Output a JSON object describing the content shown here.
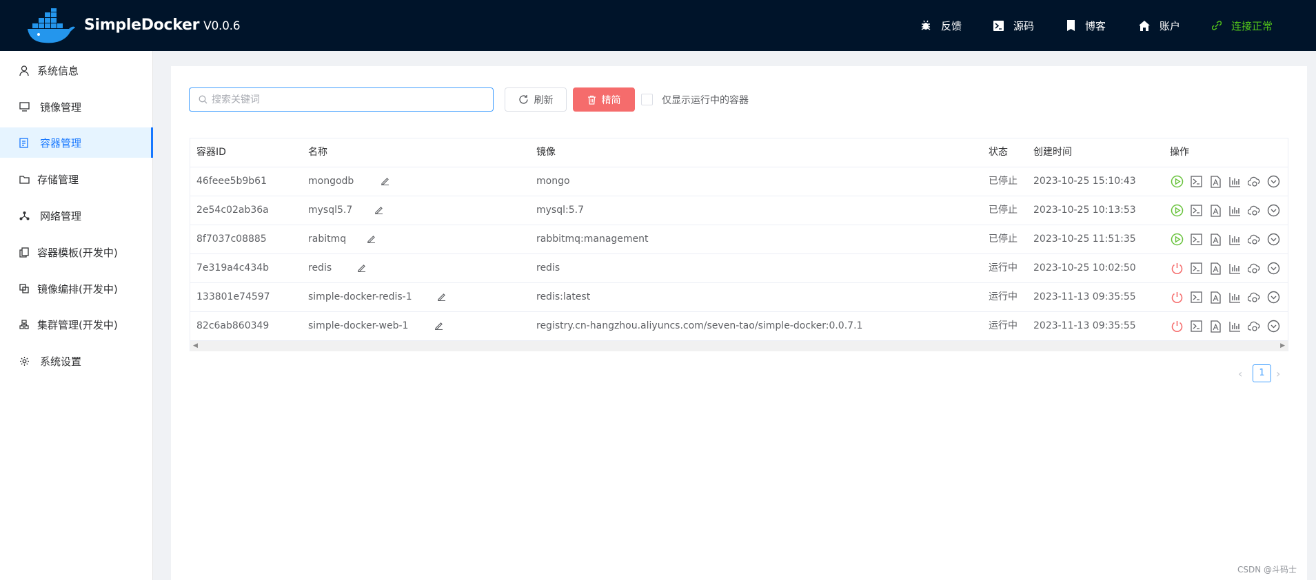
{
  "header": {
    "brand": "SimpleDocker",
    "version": "V0.0.6",
    "nav": [
      {
        "label": "反馈",
        "icon": "bug-icon"
      },
      {
        "label": "源码",
        "icon": "terminal-icon"
      },
      {
        "label": "博客",
        "icon": "book-icon"
      },
      {
        "label": "账户",
        "icon": "home-icon"
      }
    ],
    "status": {
      "label": "连接正常",
      "icon": "link-icon",
      "color": "#52c41a"
    }
  },
  "sidebar": {
    "items": [
      {
        "label": "系统信息",
        "icon": "user-icon"
      },
      {
        "label": "镜像管理",
        "icon": "monitor-icon"
      },
      {
        "label": "容器管理",
        "icon": "document-icon",
        "active": true
      },
      {
        "label": "存储管理",
        "icon": "folder-icon"
      },
      {
        "label": "网络管理",
        "icon": "network-icon"
      },
      {
        "label": "容器模板(开发中)",
        "icon": "copy-icon"
      },
      {
        "label": "镜像编排(开发中)",
        "icon": "layers-icon"
      },
      {
        "label": "集群管理(开发中)",
        "icon": "cluster-icon"
      },
      {
        "label": "系统设置",
        "icon": "gear-icon"
      }
    ]
  },
  "toolbar": {
    "search_placeholder": "搜索关键词",
    "search_value": "",
    "refresh_label": "刷新",
    "slim_label": "精简",
    "running_only_label": "仅显示运行中的容器",
    "running_only_checked": false
  },
  "table": {
    "columns": [
      "容器ID",
      "名称",
      "镜像",
      "状态",
      "创建时间",
      "操作"
    ],
    "rows": [
      {
        "id": "46feee5b9b61",
        "name": "mongodb",
        "image": "mongo",
        "status": "已停止",
        "created": "2023-10-25 15:10:43",
        "running": false
      },
      {
        "id": "2e54c02ab36a",
        "name": "mysql5.7",
        "image": "mysql:5.7",
        "status": "已停止",
        "created": "2023-10-25 10:13:53",
        "running": false
      },
      {
        "id": "8f7037c08885",
        "name": "rabitmq",
        "image": "rabbitmq:management",
        "status": "已停止",
        "created": "2023-10-25 11:51:35",
        "running": false
      },
      {
        "id": "7e319a4c434b",
        "name": "redis",
        "image": "redis",
        "status": "运行中",
        "created": "2023-10-25 10:02:50",
        "running": true
      },
      {
        "id": "133801e74597",
        "name": "simple-docker-redis-1",
        "image": "redis:latest",
        "status": "运行中",
        "created": "2023-11-13 09:35:55",
        "running": true
      },
      {
        "id": "82c6ab860349",
        "name": "simple-docker-web-1",
        "image": "registry.cn-hangzhou.aliyuncs.com/seven-tao/simple-docker:0.0.7.1",
        "status": "运行中",
        "created": "2023-11-13 09:35:55",
        "running": true
      }
    ],
    "action_icons": [
      "start-stop-icon",
      "terminal-icon",
      "log-file-icon",
      "stats-chart-icon",
      "cloud-sync-icon",
      "more-chevron-icon"
    ],
    "colors": {
      "start": "#67c23a",
      "stop": "#f56c6c"
    }
  },
  "pagination": {
    "current": "1",
    "prev": "‹",
    "next": "›"
  },
  "watermark": "CSDN @斗码士"
}
